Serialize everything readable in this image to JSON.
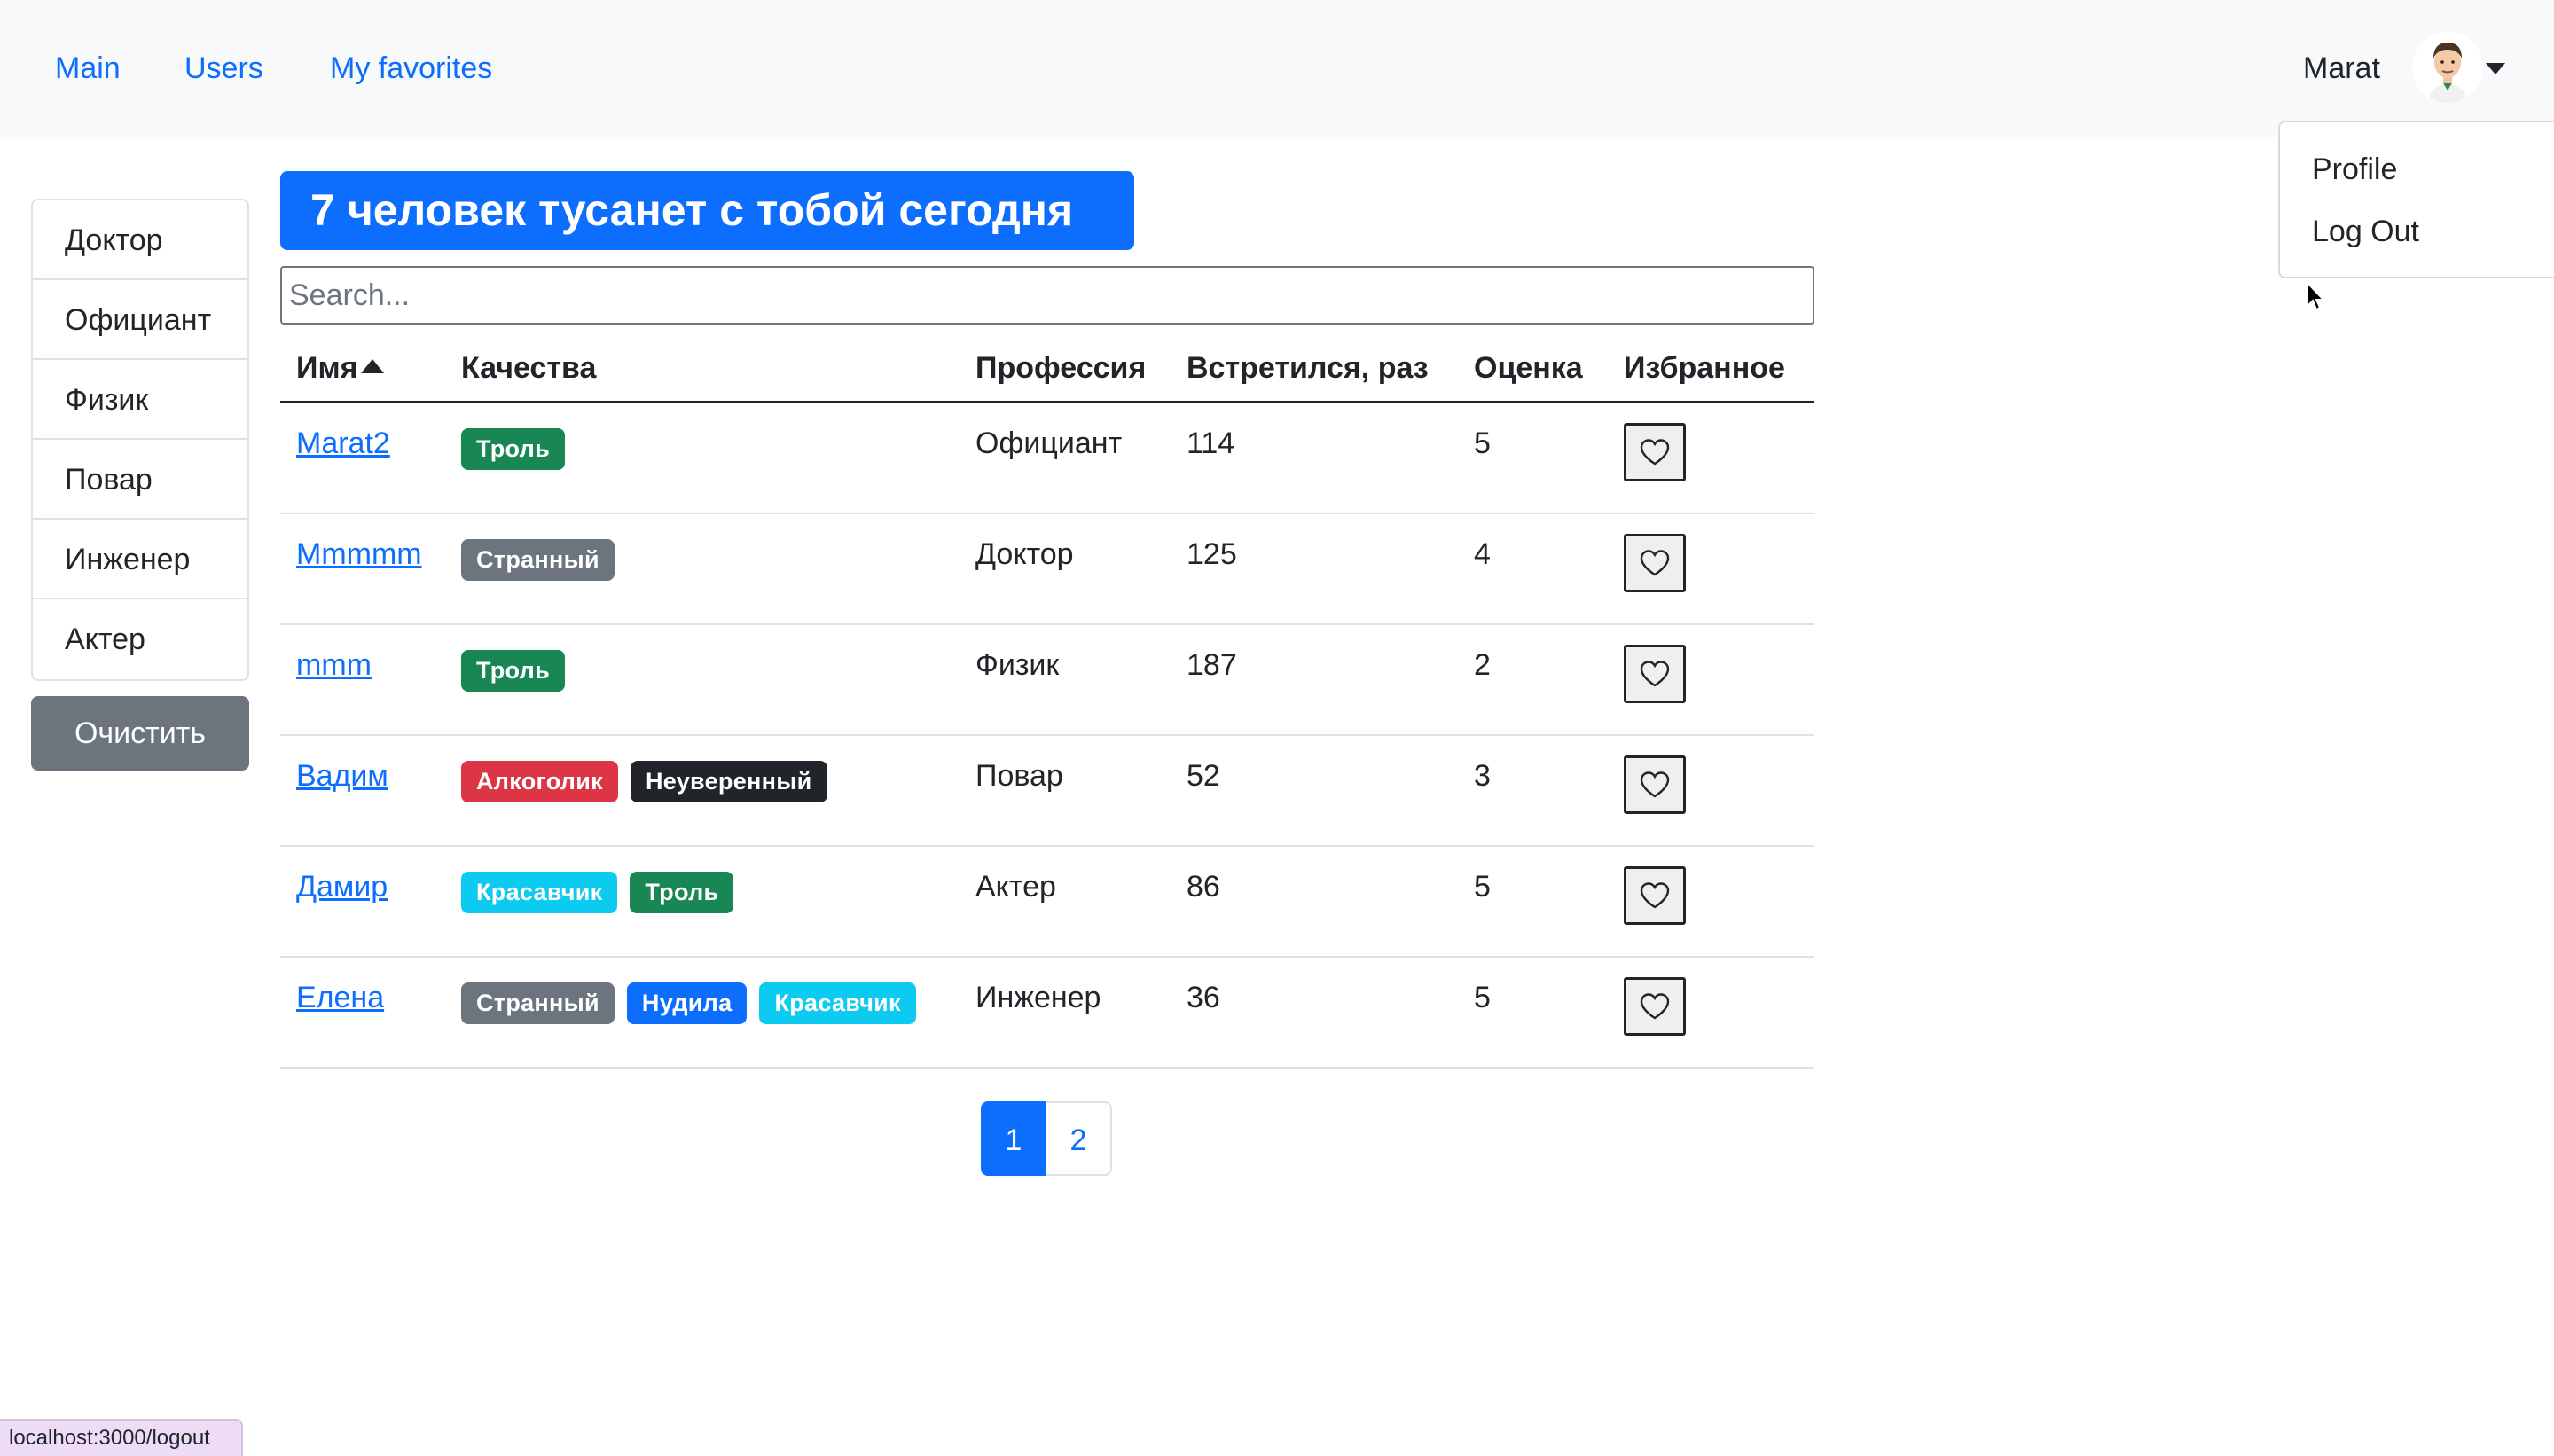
{
  "nav": {
    "links": [
      {
        "label": "Main"
      },
      {
        "label": "Users"
      },
      {
        "label": "My favorites"
      }
    ],
    "user_name": "Marat"
  },
  "dropdown": {
    "items": [
      {
        "label": "Profile"
      },
      {
        "label": "Log Out"
      }
    ]
  },
  "sidebar": {
    "professions": [
      {
        "label": "Доктор"
      },
      {
        "label": "Официант"
      },
      {
        "label": "Физик"
      },
      {
        "label": "Повар"
      },
      {
        "label": "Инженер"
      },
      {
        "label": "Актер"
      }
    ],
    "clear_label": "Очистить"
  },
  "main": {
    "title": "7 человек тусанет с тобой сегодня",
    "search_placeholder": "Search...",
    "columns": [
      "Имя",
      "Качества",
      "Профессия",
      "Встретился, раз",
      "Оценка",
      "Избранное"
    ],
    "sort_column": "Имя",
    "rows": [
      {
        "name": "Marat2",
        "qualities": [
          {
            "label": "Троль",
            "color": "#198754"
          }
        ],
        "profession": "Официант",
        "met": "114",
        "rate": "5"
      },
      {
        "name": "Mmmmm",
        "qualities": [
          {
            "label": "Странный",
            "color": "#6c757d"
          }
        ],
        "profession": "Доктор",
        "met": "125",
        "rate": "4"
      },
      {
        "name": "mmm",
        "qualities": [
          {
            "label": "Троль",
            "color": "#198754"
          }
        ],
        "profession": "Физик",
        "met": "187",
        "rate": "2"
      },
      {
        "name": "Вадим",
        "qualities": [
          {
            "label": "Алкоголик",
            "color": "#dc3545"
          },
          {
            "label": "Неуверенный",
            "color": "#212529"
          }
        ],
        "profession": "Повар",
        "met": "52",
        "rate": "3"
      },
      {
        "name": "Дамир",
        "qualities": [
          {
            "label": "Красавчик",
            "color": "#0dcaf0"
          },
          {
            "label": "Троль",
            "color": "#198754"
          }
        ],
        "profession": "Актер",
        "met": "86",
        "rate": "5"
      },
      {
        "name": "Елена",
        "qualities": [
          {
            "label": "Странный",
            "color": "#6c757d"
          },
          {
            "label": "Нудила",
            "color": "#0d6efd"
          },
          {
            "label": "Красавчик",
            "color": "#0dcaf0"
          }
        ],
        "profession": "Инженер",
        "met": "36",
        "rate": "5"
      }
    ]
  },
  "pagination": {
    "pages": [
      "1",
      "2"
    ],
    "current": "1"
  },
  "status_bar": {
    "url": "localhost:3000/logout"
  },
  "colors": {
    "primary": "#0d6efd",
    "secondary": "#6c757d",
    "navbar_bg": "#f8f9fa"
  }
}
